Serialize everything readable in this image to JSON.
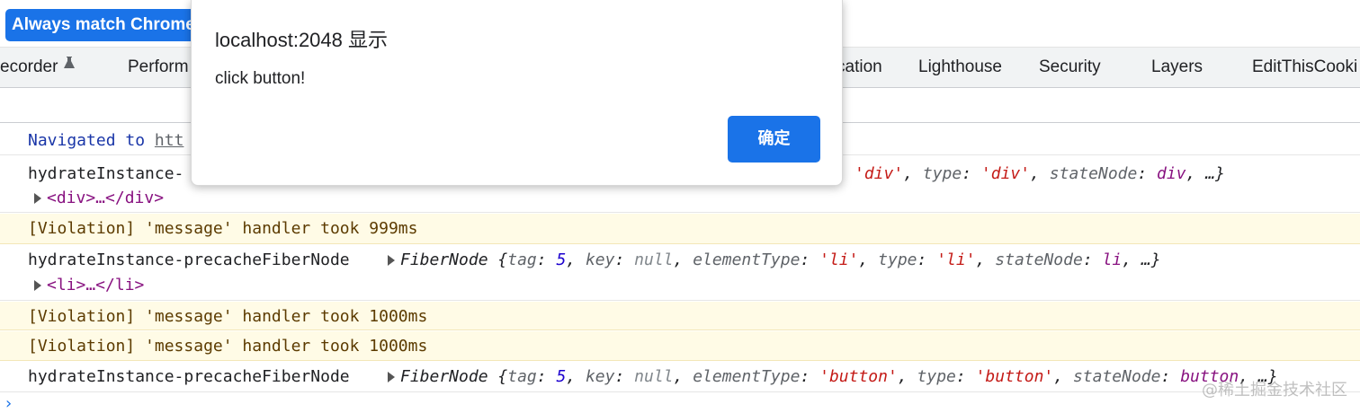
{
  "banner": {
    "match_button": "Always match Chrome"
  },
  "tabs": [
    {
      "label": "ecorder"
    },
    {
      "label": "Perform"
    },
    {
      "label": "cation"
    },
    {
      "label": "Lighthouse"
    },
    {
      "label": "Security"
    },
    {
      "label": "Layers"
    },
    {
      "label": "EditThisCooki"
    }
  ],
  "dialog": {
    "title": "localhost:2048 显示",
    "message": "click button!",
    "ok_label": "确定"
  },
  "console": {
    "navigated_prefix": "Navigated to ",
    "navigated_link": "htt",
    "row1": {
      "label": "hydrateInstance-",
      "tail_str1": "'div'",
      "tail_str2": "'div'",
      "tail_ref": "div",
      "child": "<div>…</div>"
    },
    "violation1": "[Violation] 'message' handler took 999ms",
    "row2": {
      "label": "hydrateInstance-precacheFiberNode",
      "obj": "FiberNode",
      "tag_val": "5",
      "key_val": "null",
      "etype_val": "'li'",
      "type_val": "'li'",
      "statenode_val": "li",
      "child": "<li>…</li>"
    },
    "violation2": "[Violation] 'message' handler took 1000ms",
    "violation3": "[Violation] 'message' handler took 1000ms",
    "row3": {
      "label": "hydrateInstance-precacheFiberNode",
      "obj": "FiberNode",
      "tag_val": "5",
      "key_val": "null",
      "etype_val": "'button'",
      "type_val": "'button'",
      "statenode_val": "button"
    },
    "prompt": "›"
  },
  "watermark": "@稀土掘金技术社区"
}
